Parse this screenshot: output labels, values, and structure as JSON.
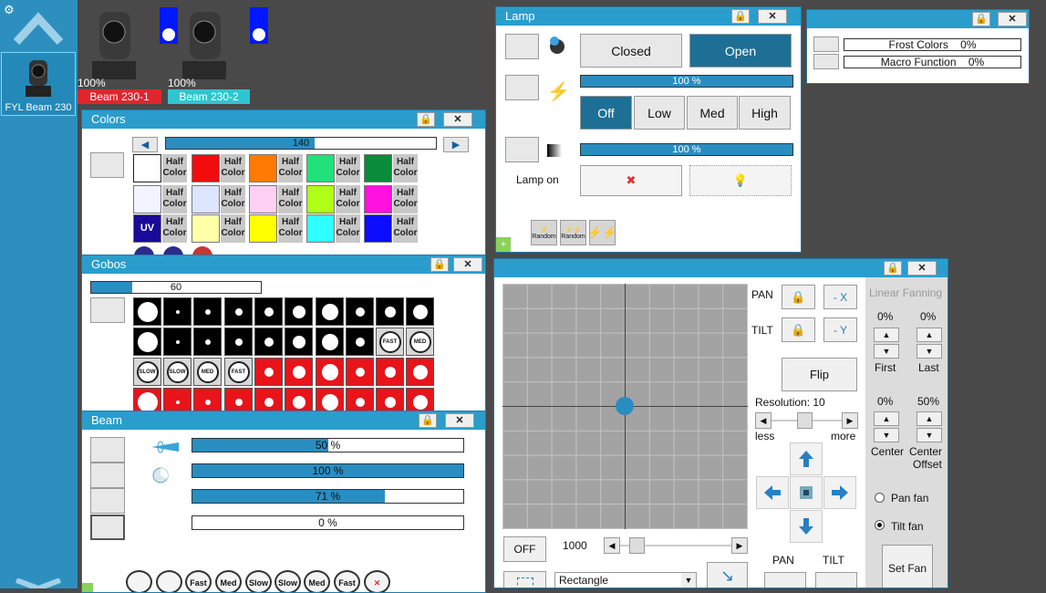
{
  "sidebar": {
    "fixture_label": "FYL Beam 230"
  },
  "fixtures": [
    {
      "percent": "100%",
      "name": "Beam 230-1",
      "color": "#e0252d"
    },
    {
      "percent": "100%",
      "name": "Beam 230-2",
      "color": "#2fc5d0"
    }
  ],
  "lamp": {
    "title": "Lamp",
    "closed": "Closed",
    "open": "Open",
    "bar1": "100 %",
    "bar1_level": 1.0,
    "off": "Off",
    "low": "Low",
    "med": "Med",
    "high": "High",
    "bar2": "100 %",
    "bar2_level": 1.0,
    "lamp_on": "Lamp on",
    "random1": "Random",
    "random2": "Random"
  },
  "frost": {
    "frost_colors": "Frost Colors",
    "frost_value": "0%",
    "macro": "Macro Function",
    "macro_value": "0%"
  },
  "colors": {
    "title": "Colors",
    "bar_value": "140",
    "bar_level": 0.55,
    "half": "Half Color",
    "uv": "UV",
    "swatches": [
      "#ffffff",
      "#f20d0d",
      "#ff7a00",
      "#22e07a",
      "#098c3a",
      "#f2f4ff",
      "#dde5ff",
      "#ffd0f5",
      "#b0ff16",
      "#ff10e0",
      "#1a0a9a",
      "#ffffa8",
      "#ffff00",
      "#2effff",
      "#0c0cff"
    ]
  },
  "gobos": {
    "title": "Gobos",
    "bar_value": "60",
    "bar_level": 0.24,
    "fast": "FAST",
    "med": "MED",
    "slow": "SLOW"
  },
  "beam": {
    "title": "Beam",
    "bars": [
      {
        "text": "50 %",
        "level": 0.5
      },
      {
        "text": "100 %",
        "level": 1.0
      },
      {
        "text": "71 %",
        "level": 0.71
      },
      {
        "text": "0 %",
        "level": 0
      }
    ],
    "bottom_labels": [
      "Fast",
      "Med",
      "Slow",
      "Slow",
      "Med",
      "Fast"
    ]
  },
  "position": {
    "pan": "PAN",
    "tilt": "TILT",
    "neg_x": "- X",
    "neg_y": "- Y",
    "flip": "Flip",
    "resolution": "Resolution: 10",
    "less": "less",
    "more": "more",
    "off": "OFF",
    "speed": "1000",
    "shape": "Rectangle",
    "pan_bottom": "PAN",
    "tilt_bottom": "TILT"
  },
  "fanning": {
    "title": "Linear Fanning",
    "first_val": "0%",
    "last_val": "0%",
    "first": "First",
    "last": "Last",
    "center_val": "0%",
    "offset_val": "50%",
    "center": "Center",
    "center_offset_1": "Center",
    "center_offset_2": "Offset",
    "pan_fan": "Pan fan",
    "tilt_fan": "Tilt fan",
    "set_fan": "Set Fan"
  }
}
